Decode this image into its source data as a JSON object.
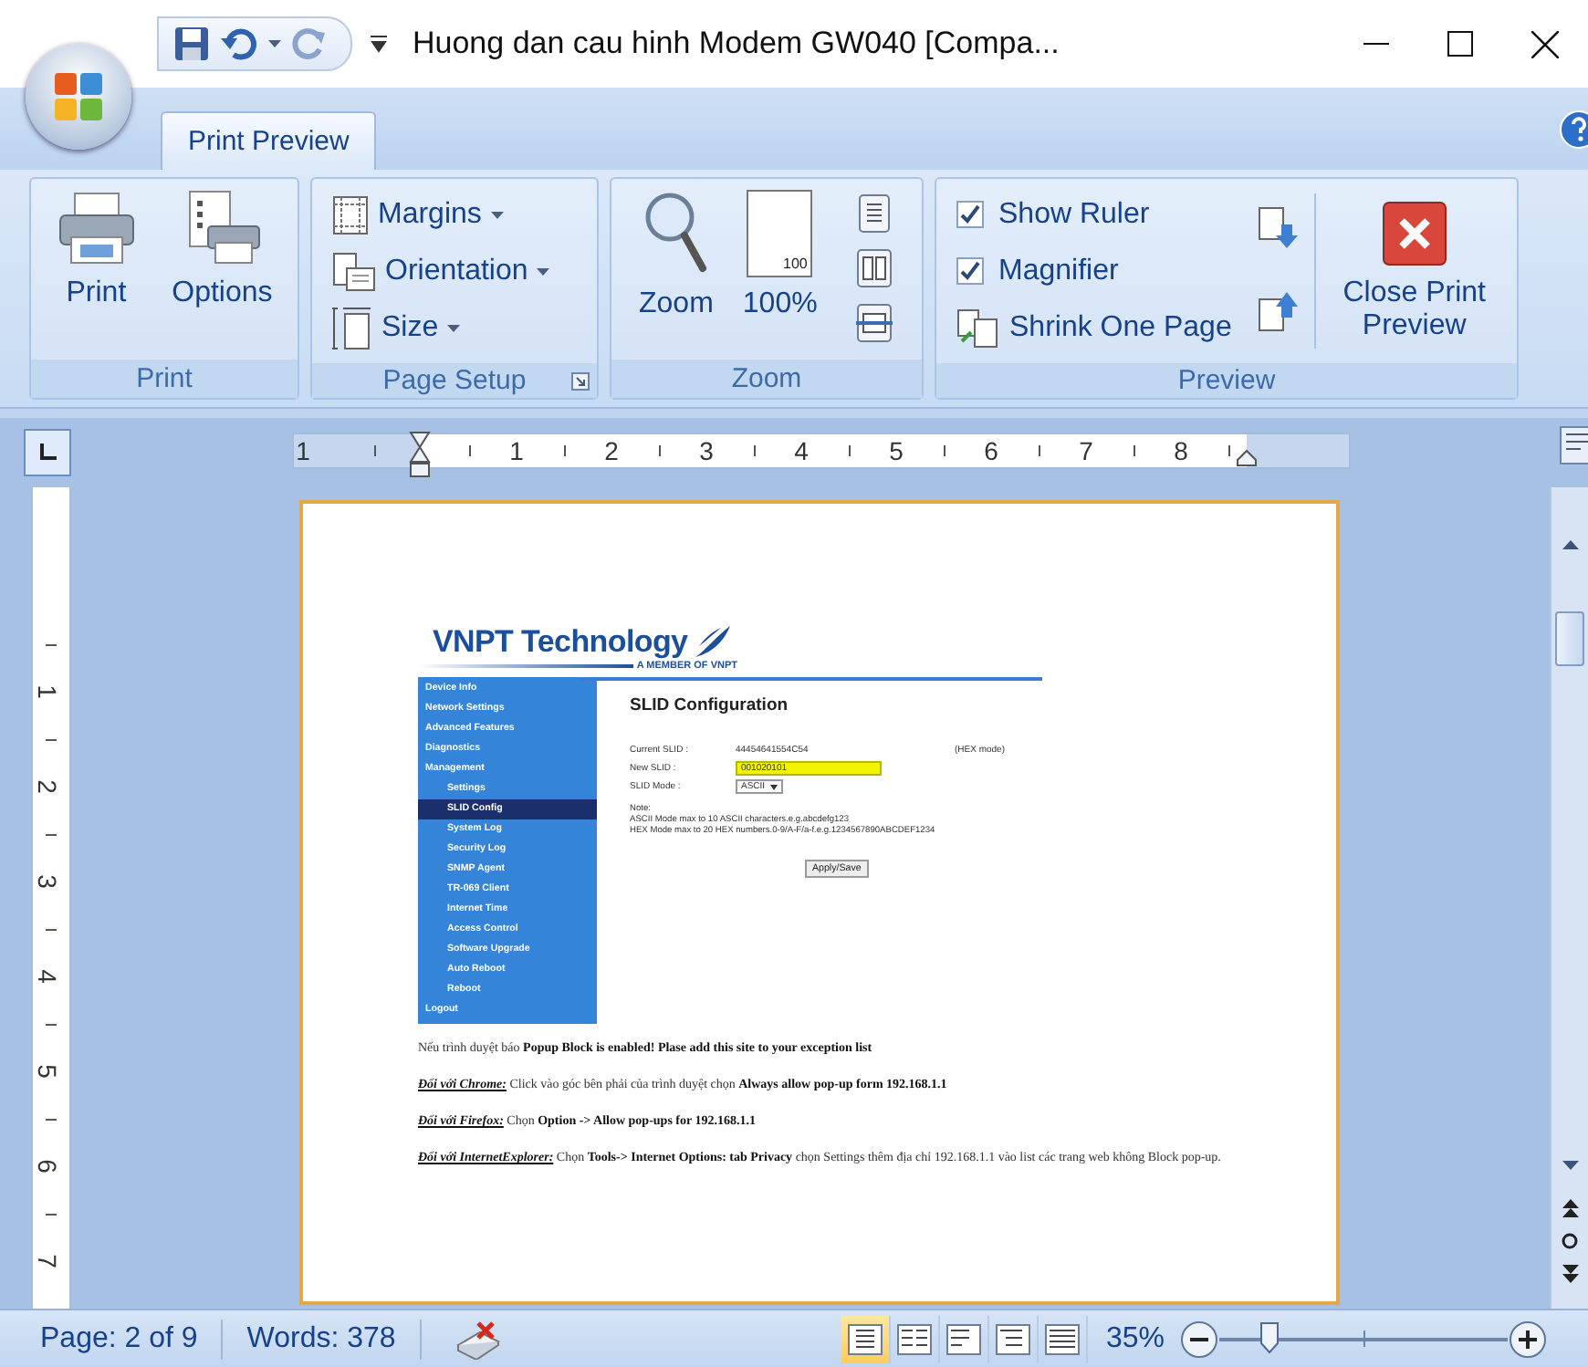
{
  "window": {
    "title": "Huong dan cau hinh Modem GW040 [Compa..."
  },
  "tabs": [
    {
      "label": "Print Preview",
      "selected": true
    }
  ],
  "ribbon": {
    "print_group": {
      "label": "Print",
      "print_button": "Print",
      "options_button": "Options"
    },
    "page_setup_group": {
      "label": "Page Setup",
      "margins_button": "Margins",
      "orientation_button": "Orientation",
      "size_button": "Size"
    },
    "zoom_group": {
      "label": "Zoom",
      "zoom_button": "Zoom",
      "zoom_100_button": "100%",
      "zoom_100_icon_text": "100"
    },
    "preview_group": {
      "label": "Preview",
      "checkboxes": [
        {
          "label": "Show Ruler",
          "checked": true
        },
        {
          "label": "Magnifier",
          "checked": true
        }
      ],
      "shrink_button": "Shrink One Page",
      "close_button": "Close Print Preview"
    }
  },
  "horizontal_ruler": {
    "labels": [
      "1",
      "1",
      "2",
      "3",
      "4",
      "5",
      "6",
      "7",
      "8"
    ]
  },
  "vertical_ruler": {
    "labels": [
      "1",
      "2",
      "3",
      "4",
      "5",
      "6",
      "7"
    ]
  },
  "document": {
    "embedded_screenshot": {
      "logo": {
        "name": "VNPT Technology",
        "tagline": "A MEMBER OF VNPT"
      },
      "sidebar": [
        {
          "label": "Device Info",
          "selected": false
        },
        {
          "label": "Network Settings",
          "selected": false
        },
        {
          "label": "Advanced Features",
          "selected": false
        },
        {
          "label": "Diagnostics",
          "selected": false
        },
        {
          "label": "Management",
          "selected": false,
          "children": [
            {
              "label": "Settings",
              "selected": false
            },
            {
              "label": "SLID Config",
              "selected": true
            },
            {
              "label": "System Log",
              "selected": false
            },
            {
              "label": "Security Log",
              "selected": false
            },
            {
              "label": "SNMP Agent",
              "selected": false
            },
            {
              "label": "TR-069 Client",
              "selected": false
            },
            {
              "label": "Internet Time",
              "selected": false
            },
            {
              "label": "Access Control",
              "selected": false
            },
            {
              "label": "Software Upgrade",
              "selected": false
            },
            {
              "label": "Auto Reboot",
              "selected": false
            },
            {
              "label": "Reboot",
              "selected": false
            }
          ]
        },
        {
          "label": "Logout",
          "selected": false
        }
      ],
      "heading": "SLID Configuration",
      "fields": [
        {
          "kind": "text",
          "label": "Current SLID :",
          "value": "44454641554C54",
          "note": "(HEX mode)"
        },
        {
          "kind": "input",
          "label": "New SLID :",
          "value": "001020101"
        },
        {
          "kind": "select",
          "label": "SLID Mode :",
          "value": "ASCII"
        }
      ],
      "note_lines": [
        "Note:",
        "ASCII Mode max to 10 ASCII characters.e.g.abcdefg123",
        "HEX Mode max to 20 HEX numbers.0-9/A-F/a-f.e.g.1234567890ABCDEF1234"
      ],
      "apply_button": "Apply/Save"
    },
    "paragraphs": [
      "Nếu trình duyệt báo **Popup Block is enabled! Plase add this site to your exception list**",
      "*Đối với Chrome:* Click vào góc bên phải của trình duyệt chọn **Always allow pop-up form 192.168.1.1**",
      "*Đối với Firefox:* Chọn **Option -> Allow pop-ups for 192.168.1.1**",
      "*Đối với InternetExplorer:* Chọn **Tools-> Internet Options: tab Privacy** chọn Settings thêm địa chỉ 192.168.1.1 vào list các trang web không Block pop-up."
    ]
  },
  "status_bar": {
    "page": "Page: 2 of 9",
    "words": "Words: 378",
    "view_buttons": [
      {
        "selected": true
      },
      {
        "selected": false
      },
      {
        "selected": false
      },
      {
        "selected": false
      },
      {
        "selected": false
      }
    ],
    "zoom_text": "35%",
    "zoom_slider": {
      "level": 0.17
    }
  }
}
